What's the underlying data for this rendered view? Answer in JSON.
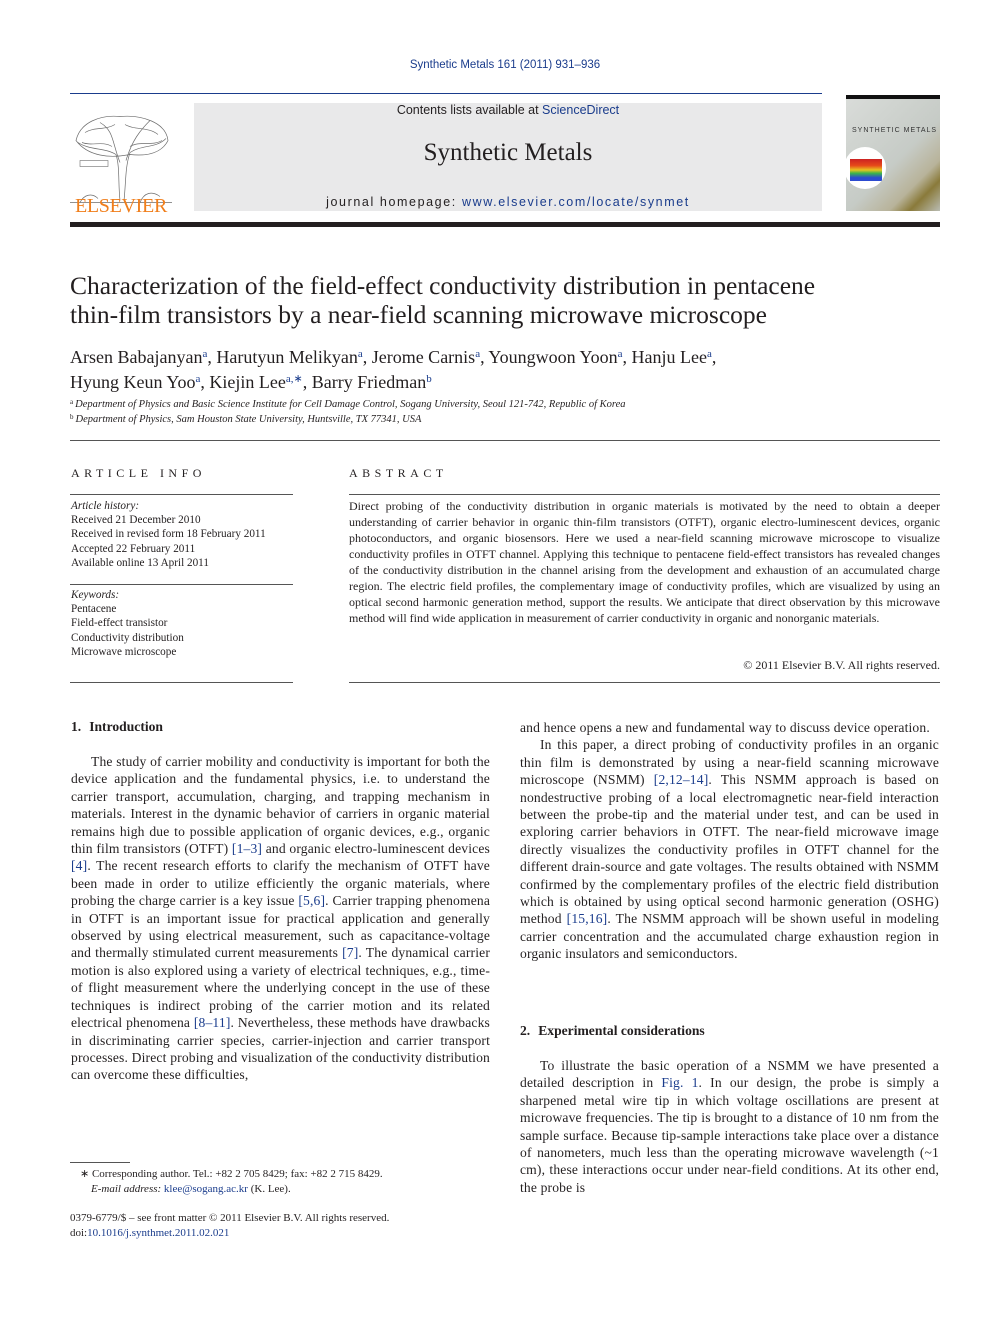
{
  "header": {
    "journal_citation": "Synthetic Metals 161 (2011) 931–936",
    "contents_prefix": "Contents lists available at ",
    "contents_link": "ScienceDirect",
    "journal_name": "Synthetic Metals",
    "homepage_prefix": "journal homepage: ",
    "homepage_link": "www.elsevier.com/locate/synmet",
    "publisher_logo_text": "ELSEVIER",
    "cover_title": "SYNTHETIC METALS",
    "colors": {
      "link": "#1a3c8c",
      "elsevier_orange": "#f07e1b",
      "banner_bg": "#e9e9ea"
    }
  },
  "article": {
    "title_line1": "Characterization of the field-effect conductivity distribution in pentacene",
    "title_line2": "thin-film transistors by a near-field scanning microwave microscope",
    "authors": [
      {
        "name": "Arsen Babajanyan",
        "affil": "a",
        "sep": ", "
      },
      {
        "name": "Harutyun Melikyan",
        "affil": "a",
        "sep": ", "
      },
      {
        "name": "Jerome Carnis",
        "affil": "a",
        "sep": ", "
      },
      {
        "name": "Youngwoon Yoon",
        "affil": "a",
        "sep": ", "
      },
      {
        "name": "Hanju Lee",
        "affil": "a",
        "sep": ","
      },
      {
        "name": "Hyung Keun Yoo",
        "affil": "a",
        "sep": ", "
      },
      {
        "name": "Kiejin Lee",
        "affil": "a,∗",
        "sep": ", "
      },
      {
        "name": "Barry Friedman",
        "affil": "b",
        "sep": ""
      }
    ],
    "affiliations": [
      {
        "mark": "a",
        "text": "Department of Physics and Basic Science Institute for Cell Damage Control, Sogang University, Seoul 121-742, Republic of Korea"
      },
      {
        "mark": "b",
        "text": "Department of Physics, Sam Houston State University, Huntsville, TX 77341, USA"
      }
    ]
  },
  "article_info": {
    "heading": "ARTICLE INFO",
    "history_label": "Article history:",
    "history": [
      "Received 21 December 2010",
      "Received in revised form 18 February 2011",
      "Accepted 22 February 2011",
      "Available online 13 April 2011"
    ],
    "keywords_label": "Keywords:",
    "keywords": [
      "Pentacene",
      "Field-effect transistor",
      "Conductivity distribution",
      "Microwave microscope"
    ]
  },
  "abstract": {
    "heading": "ABSTRACT",
    "text": "Direct probing of the conductivity distribution in organic materials is motivated by the need to obtain a deeper understanding of carrier behavior in organic thin-film transistors (OTFT), organic electro-luminescent devices, organic photoconductors, and organic biosensors. Here we used a near-field scanning microwave microscope to visualize conductivity profiles in OTFT channel. Applying this technique to pentacene field-effect transistors has revealed changes of the conductivity distribution in the channel arising from the development and exhaustion of an accumulated charge region. The electric field profiles, the complementary image of conductivity profiles, which are visualized by using an optical second harmonic generation method, support the results. We anticipate that direct observation by this microwave method will find wide application in measurement of carrier conductivity in organic and nonorganic materials.",
    "copyright": "© 2011 Elsevier B.V. All rights reserved."
  },
  "body": {
    "sec1": {
      "number": "1.",
      "title": "Introduction",
      "p1": [
        {
          "t": "The study of carrier mobility and conductivity is important for both the device application and the fundamental physics, i.e. to understand the carrier transport, accumulation, charging, and trapping mechanism in materials. Interest in the dynamic behavior of carriers in organic material remains high due to possible application of organic devices, e.g., organic thin film transistors (OTFT) "
        },
        {
          "ref": "[1–3]"
        },
        {
          "t": " and organic electro-luminescent devices "
        },
        {
          "ref": "[4]"
        },
        {
          "t": ". The recent research efforts to clarify the mechanism of OTFT have been made in order to utilize efficiently the organic materials, where probing the charge carrier is a key issue "
        },
        {
          "ref": "[5,6]"
        },
        {
          "t": ". Carrier trapping phenomena in OTFT is an important issue for practical application and generally observed by using electrical measurement, such as capacitance-voltage and thermally stimulated current measurements "
        },
        {
          "ref": "[7]"
        },
        {
          "t": ". The dynamical carrier motion is also explored using a variety of electrical techniques, e.g., time-of flight measurement where the underlying concept in the use of these techniques is indirect probing of the carrier motion and its related electrical phenomena "
        },
        {
          "ref": "[8–11]"
        },
        {
          "t": ". Nevertheless, these methods have drawbacks in discriminating carrier species, carrier-injection and carrier transport processes. Direct probing and visualization of the conductivity distribution can overcome these difficulties,"
        }
      ],
      "p1_cont": "and hence opens a new and fundamental way to discuss device operation.",
      "p2": [
        {
          "t": "In this paper, a direct probing of conductivity profiles in an organic thin film is demonstrated by using a near-field scanning microwave microscope (NSMM) "
        },
        {
          "ref": "[2,12–14]"
        },
        {
          "t": ". This NSMM approach is based on nondestructive probing of a local electromagnetic near-field interaction between the probe-tip and the material under test, and can be used in exploring carrier behaviors in OTFT. The near-field microwave image directly visualizes the conductivity profiles in OTFT channel for the different drain-source and gate voltages. The results obtained with NSMM confirmed by the complementary profiles of the electric field distribution which is obtained by using optical second harmonic generation (OSHG) method "
        },
        {
          "ref": "[15,16]"
        },
        {
          "t": ". The NSMM approach will be shown useful in modeling carrier concentration and the accumulated charge exhaustion region in organic insulators and semiconductors."
        }
      ]
    },
    "sec2": {
      "number": "2.",
      "title": "Experimental considerations",
      "p1": [
        {
          "t": "To illustrate the basic operation of a NSMM we have presented a detailed description in "
        },
        {
          "ref": "Fig. 1"
        },
        {
          "t": ". In our design, the probe is simply a sharpened metal wire tip in which voltage oscillations are present at microwave frequencies. The tip is brought to a distance of 10 nm from the sample surface. Because tip-sample interactions take place over a distance of nanometers, much less than the operating microwave wavelength (~1 cm), these interactions occur under near-field conditions. At its other end, the probe is"
        }
      ]
    }
  },
  "footnotes": {
    "corresponding": "∗ Corresponding author. Tel.: +82 2 705 8429; fax: +82 2 715 8429.",
    "email_label": "E-mail address: ",
    "email": "klee@sogang.ac.kr",
    "email_suffix": " (K. Lee).",
    "issn_line": "0379-6779/$ – see front matter © 2011 Elsevier B.V. All rights reserved.",
    "doi_prefix": "doi:",
    "doi": "10.1016/j.synthmet.2011.02.021"
  }
}
